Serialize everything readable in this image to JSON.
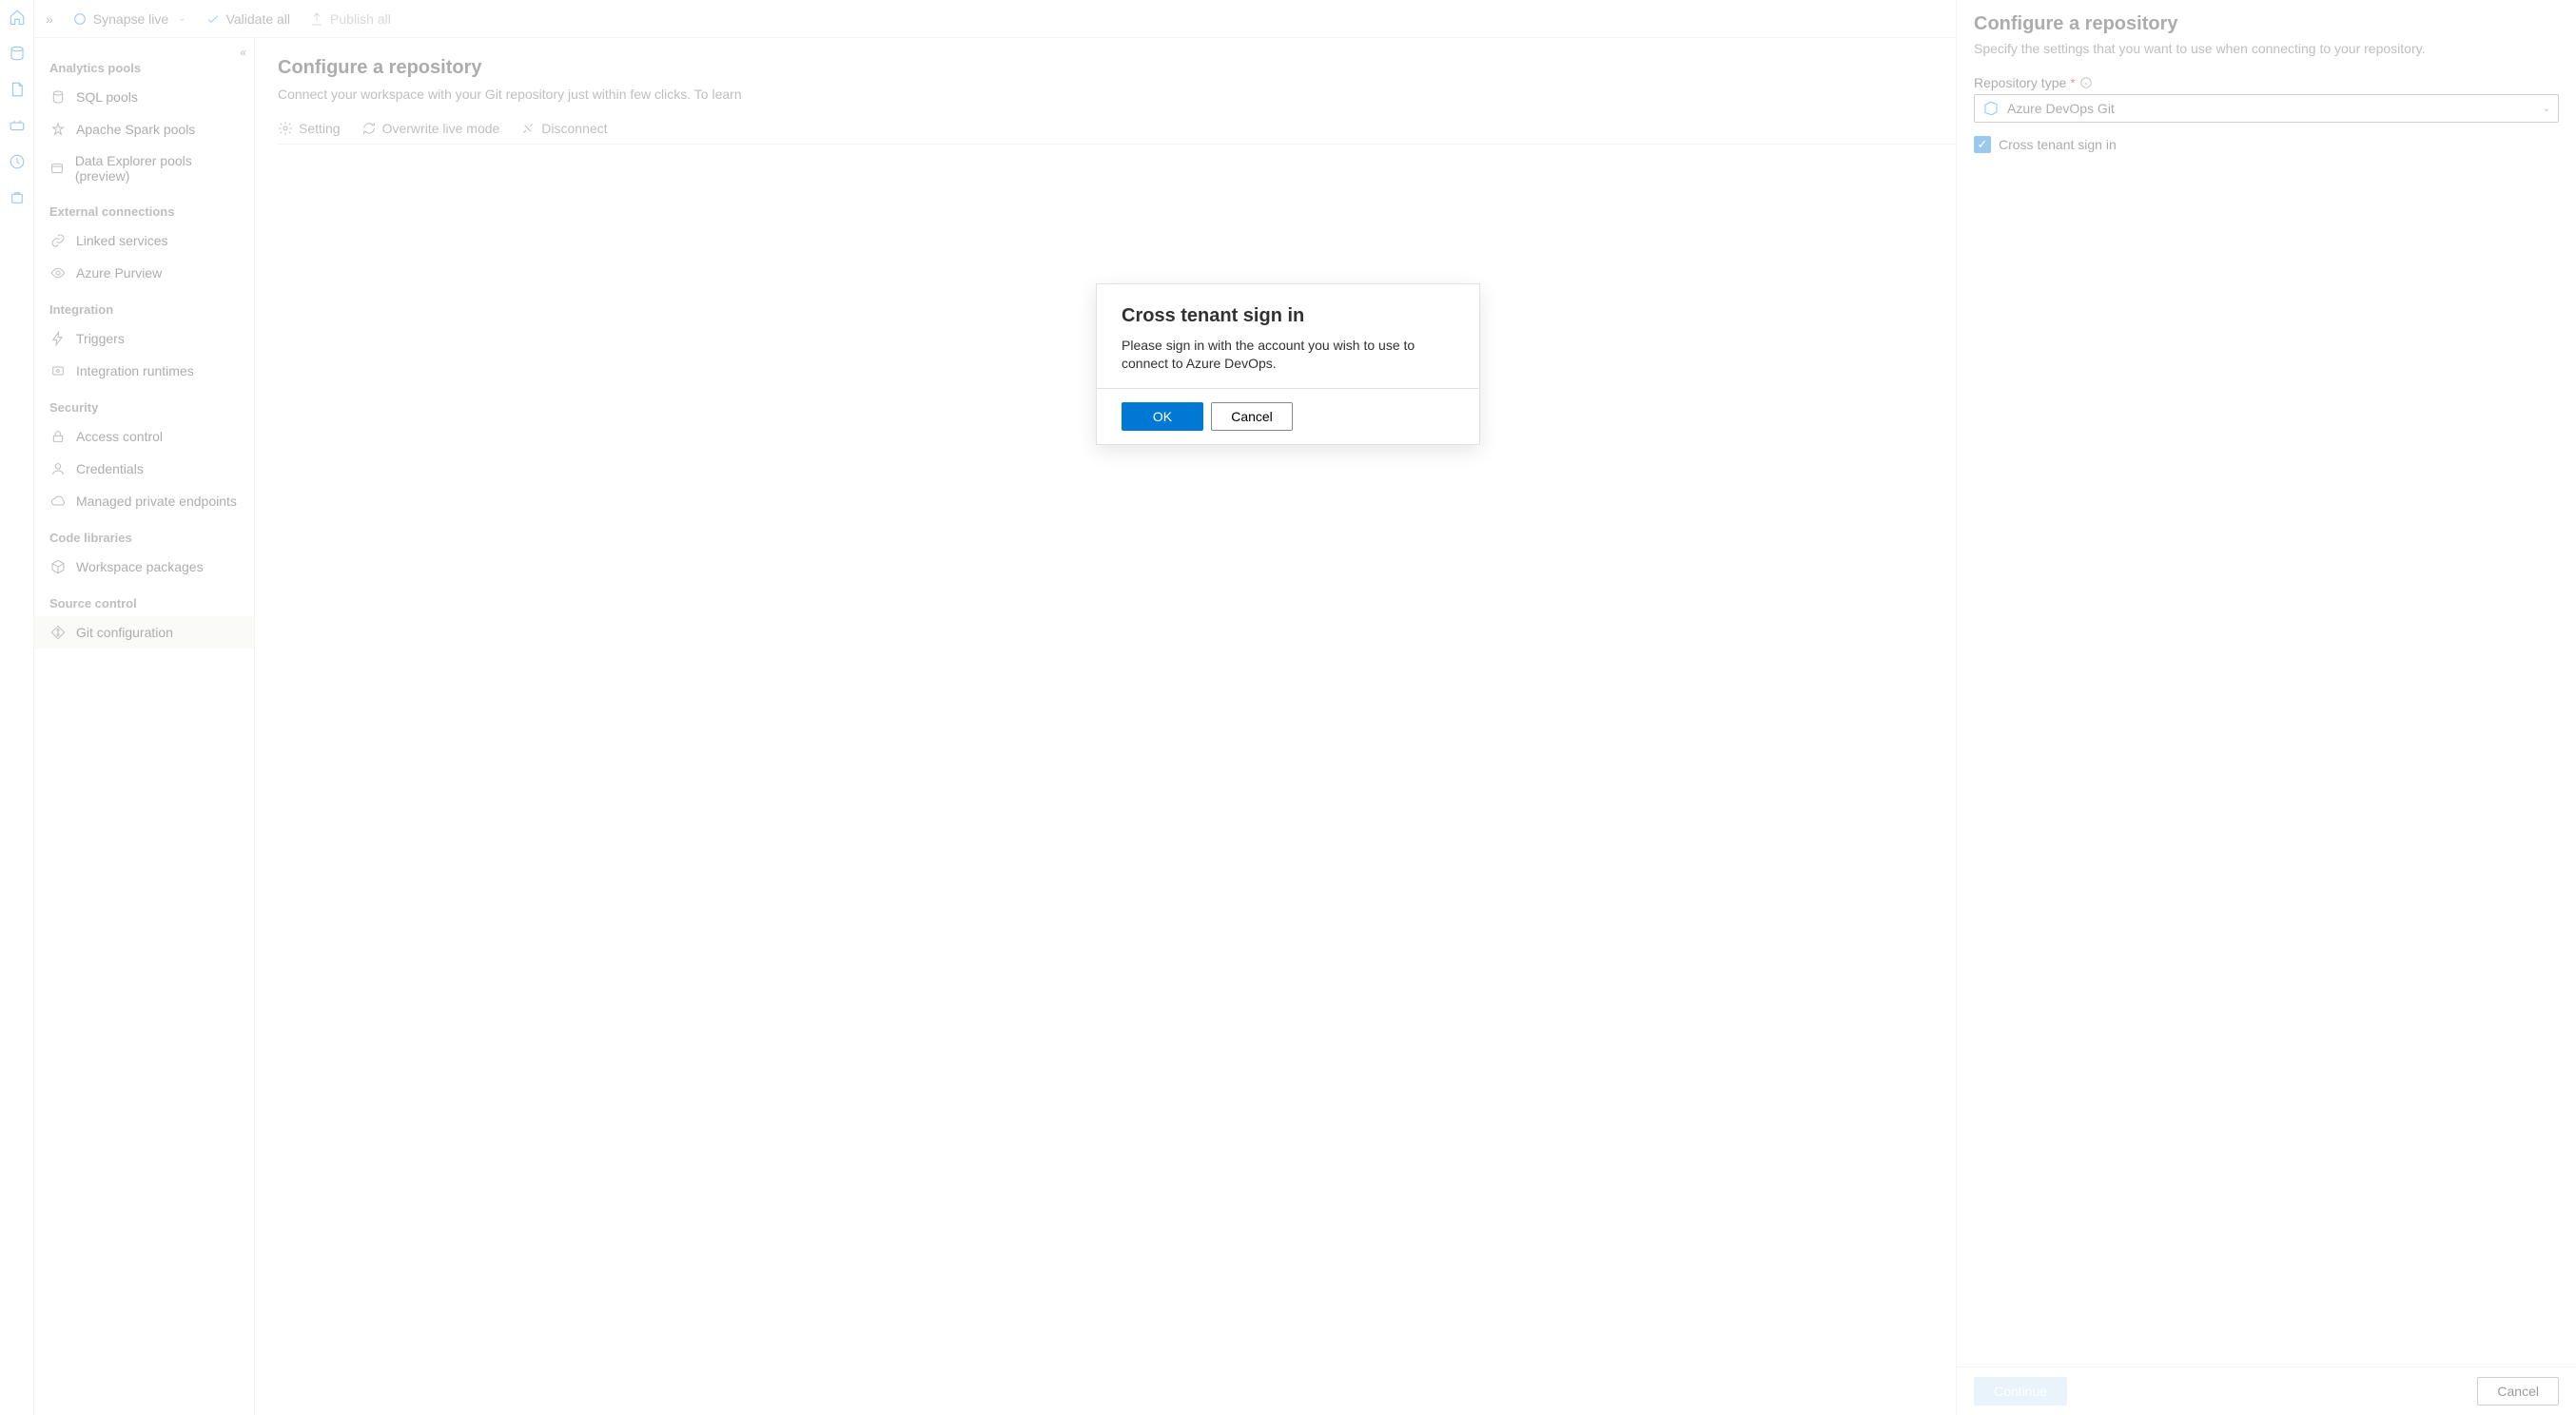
{
  "toolbar": {
    "workspace_mode": "Synapse live",
    "validate_all": "Validate all",
    "publish_all": "Publish all"
  },
  "sidebar": {
    "sections": [
      {
        "title": "Analytics pools",
        "items": [
          {
            "label": "SQL pools",
            "icon": "database-icon"
          },
          {
            "label": "Apache Spark pools",
            "icon": "spark-icon"
          },
          {
            "label": "Data Explorer pools (preview)",
            "icon": "explorer-icon"
          }
        ]
      },
      {
        "title": "External connections",
        "items": [
          {
            "label": "Linked services",
            "icon": "link-icon"
          },
          {
            "label": "Azure Purview",
            "icon": "eye-icon"
          }
        ]
      },
      {
        "title": "Integration",
        "items": [
          {
            "label": "Triggers",
            "icon": "bolt-icon"
          },
          {
            "label": "Integration runtimes",
            "icon": "runtime-icon"
          }
        ]
      },
      {
        "title": "Security",
        "items": [
          {
            "label": "Access control",
            "icon": "access-icon"
          },
          {
            "label": "Credentials",
            "icon": "person-icon"
          },
          {
            "label": "Managed private endpoints",
            "icon": "cloud-icon"
          }
        ]
      },
      {
        "title": "Code libraries",
        "items": [
          {
            "label": "Workspace packages",
            "icon": "package-icon"
          }
        ]
      },
      {
        "title": "Source control",
        "items": [
          {
            "label": "Git configuration",
            "icon": "git-icon",
            "active": true
          }
        ]
      }
    ]
  },
  "main": {
    "title": "Configure a repository",
    "subtitle": "Connect your workspace with your Git repository just within few clicks. To learn",
    "tabs": [
      {
        "label": "Setting",
        "icon": "gear-icon"
      },
      {
        "label": "Overwrite live mode",
        "icon": "refresh-icon"
      },
      {
        "label": "Disconnect",
        "icon": "disconnect-icon"
      }
    ]
  },
  "panel": {
    "title": "Configure a repository",
    "desc": "Specify the settings that you want to use when connecting to your repository.",
    "repo_type_label": "Repository type",
    "repo_type_value": "Azure DevOps Git",
    "cross_tenant_label": "Cross tenant sign in",
    "continue": "Continue",
    "cancel": "Cancel"
  },
  "modal": {
    "title": "Cross tenant sign in",
    "body": "Please sign in with the account you wish to use to connect to Azure DevOps.",
    "ok": "OK",
    "cancel": "Cancel"
  }
}
